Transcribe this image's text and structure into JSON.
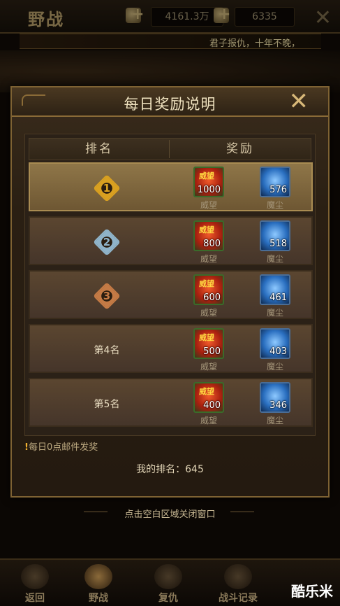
{
  "top_bar": {
    "title": "野战",
    "resource_1": "4161.3万",
    "resource_2": "6335",
    "plus": "+",
    "close": "✕"
  },
  "ticker": {
    "text": "君子报仇，十年不晚，"
  },
  "dialog": {
    "title": "每日奖励说明",
    "close": "✕",
    "columns": {
      "rank": "排名",
      "reward": "奖励"
    },
    "rows": [
      {
        "rank": "1",
        "rank_label": "",
        "badge_color": "#d9a020",
        "prestige": {
          "tag": "威望",
          "qty": "1000",
          "name": "威望"
        },
        "dust": {
          "qty": "576",
          "name": "魔尘"
        }
      },
      {
        "rank": "2",
        "rank_label": "",
        "badge_color": "#8fb3c9",
        "prestige": {
          "tag": "威望",
          "qty": "800",
          "name": "威望"
        },
        "dust": {
          "qty": "518",
          "name": "魔尘"
        }
      },
      {
        "rank": "3",
        "rank_label": "",
        "badge_color": "#c47a45",
        "prestige": {
          "tag": "威望",
          "qty": "600",
          "name": "威望"
        },
        "dust": {
          "qty": "461",
          "name": "魔尘"
        }
      },
      {
        "rank": "",
        "rank_label": "第4名",
        "badge_color": "",
        "prestige": {
          "tag": "威望",
          "qty": "500",
          "name": "威望"
        },
        "dust": {
          "qty": "403",
          "name": "魔尘"
        }
      },
      {
        "rank": "",
        "rank_label": "第5名",
        "badge_color": "",
        "prestige": {
          "tag": "威望",
          "qty": "400",
          "name": "威望"
        },
        "dust": {
          "qty": "346",
          "name": "魔尘"
        }
      }
    ],
    "note": "每日0点邮件发奖",
    "note_mark": "!",
    "my_rank": "我的排名：645"
  },
  "hint": "点击空白区域关闭窗口",
  "bottom_nav": [
    {
      "label": "返回"
    },
    {
      "label": "野战"
    },
    {
      "label": "复仇"
    },
    {
      "label": "战斗记录"
    }
  ],
  "watermark": "酷乐米"
}
